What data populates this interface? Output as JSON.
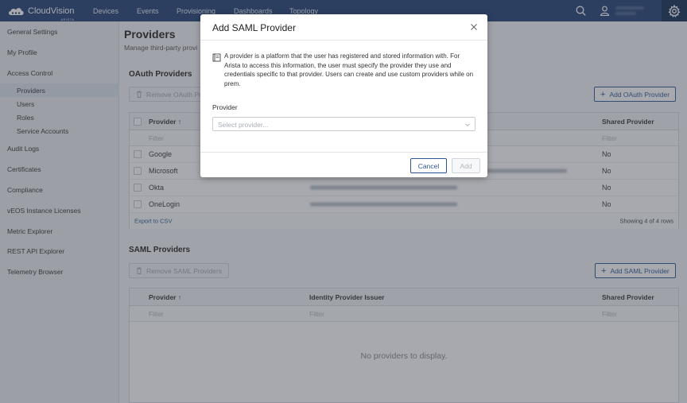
{
  "app": {
    "logo_text": "CloudVision",
    "logo_sub": "ARISTA"
  },
  "nav": {
    "items": [
      "Devices",
      "Events",
      "Provisioning",
      "Dashboards",
      "Topology"
    ]
  },
  "sidebar": {
    "items": [
      "General Settings",
      "My Profile",
      "Access Control",
      "Providers",
      "Users",
      "Roles",
      "Service Accounts",
      "Audit Logs",
      "Certificates",
      "Compliance",
      "vEOS Instance Licenses",
      "Metric Explorer",
      "REST API Explorer",
      "Telemetry Browser"
    ],
    "active": "Providers"
  },
  "page": {
    "title": "Providers",
    "subtitle": "Manage third-party provi"
  },
  "oauth": {
    "title": "OAuth Providers",
    "remove_label": "Remove OAuth Pr",
    "add_label": "Add OAuth Provider",
    "columns": {
      "provider": "Provider",
      "shared": "Shared Provider"
    },
    "filter_placeholder": "Filter",
    "rows": [
      {
        "name": "Google",
        "shared": "No"
      },
      {
        "name": "Microsoft",
        "shared": "No"
      },
      {
        "name": "Okta",
        "shared": "No"
      },
      {
        "name": "OneLogin",
        "shared": "No"
      }
    ],
    "export_label": "Export to CSV",
    "showing": "Showing 4 of 4 rows"
  },
  "saml": {
    "title": "SAML Providers",
    "remove_label": "Remove SAML Providers",
    "add_label": "Add SAML Provider",
    "columns": {
      "provider": "Provider",
      "issuer": "Identity Provider Issuer",
      "shared": "Shared Provider"
    },
    "filter_placeholder": "Filter",
    "empty": "No providers to display."
  },
  "modal": {
    "title": "Add SAML Provider",
    "info": "A provider is a platform that the user has registered and stored information with. For Arista to access this information, the user must specify the provider they use and credentials specific to that provider. Users can create and use custom providers while on prem.",
    "field_label": "Provider",
    "select_placeholder": "Select provider...",
    "cancel_label": "Cancel",
    "add_label": "Add"
  },
  "colors": {
    "topbar": "#1f3f71",
    "accent": "#2c5694"
  }
}
